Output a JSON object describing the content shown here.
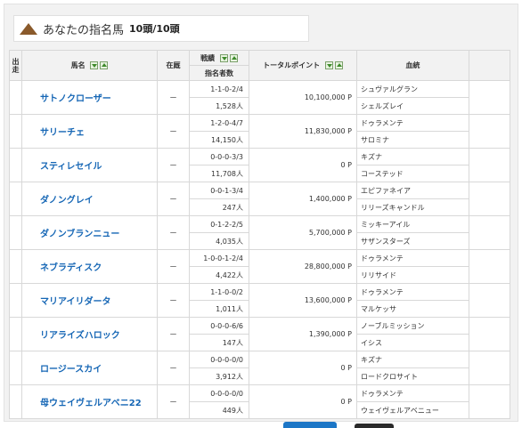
{
  "header": {
    "title": "あなたの指名馬",
    "count": "10頭/10頭"
  },
  "columns": {
    "start_top": "出",
    "start_bottom": "走",
    "name": "馬名",
    "stable": "在厩",
    "record": "戦績",
    "nominators": "指名者数",
    "points": "トータルポイント",
    "bloodline": "血統"
  },
  "horses": [
    {
      "name": "サトノクローザー",
      "stable": "－",
      "record": "1-1-0-2/4",
      "nominators": "1,528人",
      "points": "10,100,000 P",
      "sire": "シュヴァルグラン",
      "dam": "シェルズレイ"
    },
    {
      "name": "サリーチェ",
      "stable": "－",
      "record": "1-2-0-4/7",
      "nominators": "14,150人",
      "points": "11,830,000 P",
      "sire": "ドゥラメンテ",
      "dam": "サロミナ"
    },
    {
      "name": "スティレセイル",
      "stable": "－",
      "record": "0-0-0-3/3",
      "nominators": "11,708人",
      "points": "0 P",
      "sire": "キズナ",
      "dam": "コーステッド"
    },
    {
      "name": "ダノングレイ",
      "stable": "－",
      "record": "0-0-1-3/4",
      "nominators": "247人",
      "points": "1,400,000 P",
      "sire": "エピファネイア",
      "dam": "リリーズキャンドル"
    },
    {
      "name": "ダノンブランニュー",
      "stable": "－",
      "record": "0-1-2-2/5",
      "nominators": "4,035人",
      "points": "5,700,000 P",
      "sire": "ミッキーアイル",
      "dam": "サザンスターズ"
    },
    {
      "name": "ネブラディスク",
      "stable": "－",
      "record": "1-0-0-1-2/4",
      "nominators": "4,422人",
      "points": "28,800,000 P",
      "sire": "ドゥラメンテ",
      "dam": "リリサイド"
    },
    {
      "name": "マリアイリダータ",
      "stable": "－",
      "record": "1-1-0-0/2",
      "nominators": "1,011人",
      "points": "13,600,000 P",
      "sire": "ドゥラメンテ",
      "dam": "マルケッサ"
    },
    {
      "name": "リアライズハロック",
      "stable": "－",
      "record": "0-0-0-6/6",
      "nominators": "147人",
      "points": "1,390,000 P",
      "sire": "ノーブルミッション",
      "dam": "イシス"
    },
    {
      "name": "ロージースカイ",
      "stable": "－",
      "record": "0-0-0-0/0",
      "nominators": "3,912人",
      "points": "0 P",
      "sire": "キズナ",
      "dam": "ロードクロサイト"
    },
    {
      "name": "母ウェイヴェルアベニ22",
      "stable": "－",
      "record": "0-0-0-0/0",
      "nominators": "449人",
      "points": "0 P",
      "sire": "ドゥラメンテ",
      "dam": "ウェイヴェルアベニュー"
    }
  ]
}
